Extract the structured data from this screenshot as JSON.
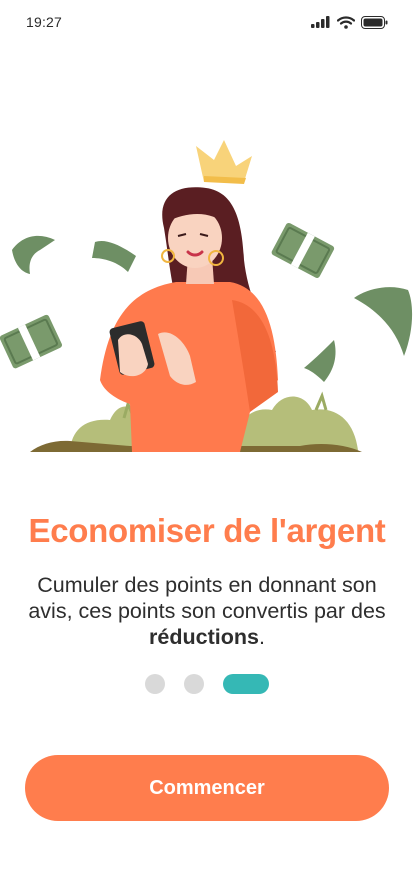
{
  "status_bar": {
    "time": "19:27",
    "icons": [
      "cellular-signal-icon",
      "wifi-icon",
      "battery-icon"
    ]
  },
  "onboarding": {
    "illustration": "woman-with-phone-and-money-illustration",
    "title": "Economiser de l'argent",
    "description_lead": "Cumuler des points en donnant son avis, ces points son convertis par des ",
    "description_bold": "réductions",
    "description_end": ".",
    "pagination": {
      "total": 3,
      "current": 3
    },
    "cta_label": "Commencer"
  },
  "colors": {
    "accent": "#ff7d4d",
    "pagination_active": "#35b8b5",
    "pagination_inactive": "#d9d9d9",
    "money_green": "#6e8f64"
  }
}
